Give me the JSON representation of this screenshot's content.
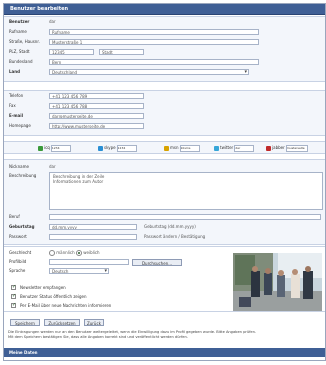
{
  "header": {
    "title": "Benutzer bearbeiten"
  },
  "identity": {
    "rows": [
      {
        "label": "Benutzer",
        "value": "dar",
        "bold": true,
        "kind": "text"
      },
      {
        "label": "Rufname",
        "value": "Rufname",
        "bold": false,
        "kind": "input"
      },
      {
        "label": "Straße, Hausnr.",
        "value": "Musterstraße 1",
        "bold": false,
        "kind": "input"
      },
      {
        "label": "PLZ, Stadt",
        "value": "12345",
        "value2": "Stadt",
        "bold": false,
        "kind": "zip"
      },
      {
        "label": "Bundesland",
        "value": "Bern",
        "bold": false,
        "kind": "input"
      },
      {
        "label": "Land",
        "value": "Deutschland",
        "bold": true,
        "kind": "select"
      }
    ]
  },
  "contact": {
    "rows": [
      {
        "label": "Telefon",
        "value": "+41 123 456 789",
        "bold": false
      },
      {
        "label": "Fax",
        "value": "+41 123 456 788",
        "bold": false
      },
      {
        "label": "E-mail",
        "value": "dar@musterseite.de",
        "bold": true
      },
      {
        "label": "Homepage",
        "value": "http://www.musterseite.de",
        "bold": false
      }
    ]
  },
  "social": [
    {
      "name": "icq",
      "value": "1234",
      "color": "#3a9a3a"
    },
    {
      "name": "skype",
      "value": "1234",
      "color": "#2a8fd4"
    },
    {
      "name": "msn",
      "value": "10sms",
      "color": "#d8a300"
    },
    {
      "name": "twitter",
      "value": "dar",
      "color": "#36a6d8"
    },
    {
      "name": "jabber",
      "value": "musterseite",
      "color": "#c02a2a"
    }
  ],
  "about": {
    "nickname_label": "Nickname",
    "nickname": "dar",
    "desc_label": "Beschreibung",
    "desc_line1": "Beschreibung in der Zeile",
    "desc_line2": "Informationen zum Autor",
    "beruf_label": "Beruf",
    "geburtstag_label": "Geburtstag",
    "geburtstag": "dd.mm.yyyy",
    "geburtstag_hint": "Geburtstag (dd.mm.yyyy)",
    "passwort_label": "Passwort",
    "passwort_hint": "Passwort ändern / Bestätigung"
  },
  "profile": {
    "gender_label": "Geschlecht",
    "gender_m": "männlich",
    "gender_w": "weiblich",
    "photo_label": "Profilbild",
    "browse": "Durchsuchen...",
    "lang_label": "Sprache",
    "lang_value": "Deutsch"
  },
  "checkboxes": [
    {
      "label": "Newsletter empfangen",
      "checked": true
    },
    {
      "label": "Benutzer Status öffentlich zeigen",
      "checked": true
    },
    {
      "label": "Per E-Mail über neue Nachrichten informieren",
      "checked": true
    }
  ],
  "buttons": {
    "save": "Speichern",
    "reset": "Zurücksetzen",
    "back": "Zurück"
  },
  "note": {
    "line1": "Die Eintragungen werden nur an den Benutzer weitergeleitet, wenn die Einwilligung dazu im Profil gegeben wurde. Bitte Angaben prüfen.",
    "line2": "Mit dem Speichern bestätigen Sie, dass alle Angaben korrekt sind und veröffentlicht werden dürfen."
  },
  "footer": {
    "title": "Meine Daten"
  },
  "colors": {
    "accent": "#3f5f95",
    "panel": "#f3f6fb",
    "border": "#a7b3c8"
  }
}
